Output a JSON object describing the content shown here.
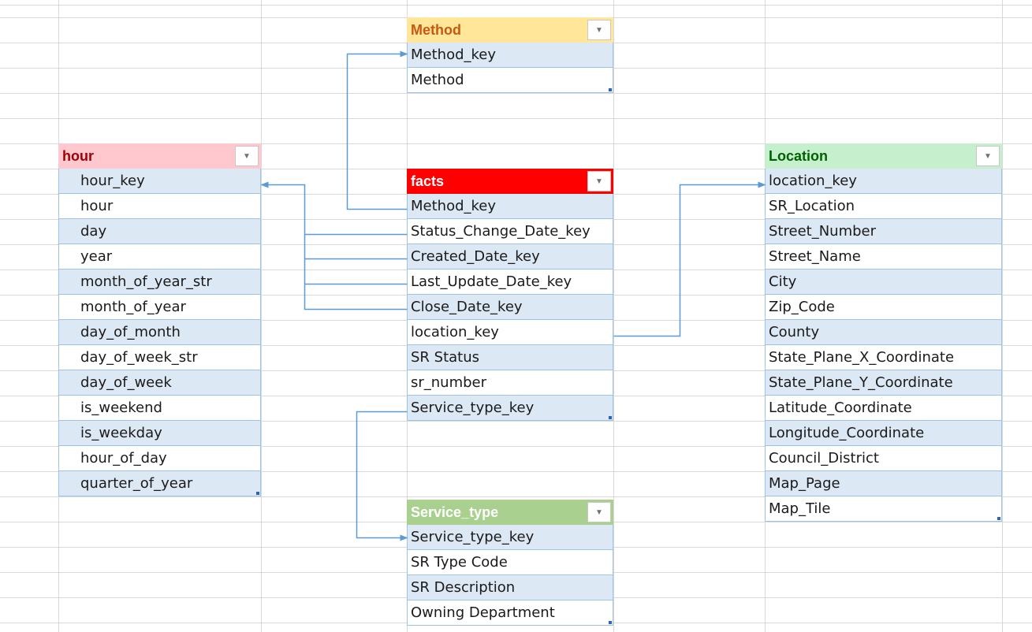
{
  "tables": {
    "method": {
      "title": "Method",
      "header_bg": "#ffe699",
      "header_color": "#c65911",
      "fields": [
        "Method_key",
        "Method"
      ]
    },
    "hour": {
      "title": "hour",
      "header_bg": "#ffc7ce",
      "header_color": "#9c0006",
      "fields": [
        "hour_key",
        "hour",
        "day",
        "year",
        "month_of_year_str",
        "month_of_year",
        "day_of_month",
        "day_of_week_str",
        "day_of_week",
        "is_weekend",
        "is_weekday",
        "hour_of_day",
        "quarter_of_year"
      ]
    },
    "facts": {
      "title": "facts",
      "header_bg": "#ff0000",
      "header_color": "#ffffff",
      "fields": [
        "Method_key",
        "Status_Change_Date_key",
        "Created_Date_key",
        "Last_Update_Date_key",
        "Close_Date_key",
        "location_key",
        "SR Status",
        "sr_number",
        "Service_type_key"
      ]
    },
    "location": {
      "title": "Location",
      "header_bg": "#c6efce",
      "header_color": "#006100",
      "fields": [
        "location_key",
        "SR_Location",
        "Street_Number",
        "Street_Name",
        "City",
        "Zip_Code",
        "County",
        "State_Plane_X_Coordinate",
        "State_Plane_Y_Coordinate",
        "Latitude_Coordinate",
        "Longitude_Coordinate",
        "Council_District",
        "Map_Page",
        "Map_Tile"
      ]
    },
    "service_type": {
      "title": "Service_type",
      "header_bg": "#a9d08e",
      "header_color": "#ffffff",
      "fields": [
        "Service_type_key",
        "SR Type Code",
        "SR Description",
        "Owning Department"
      ]
    }
  },
  "colors": {
    "link_line": "#5b9bd5",
    "grid_line": "#d9d9d9",
    "row_band": "#dde8f5",
    "row_border": "#9dc3e6"
  }
}
